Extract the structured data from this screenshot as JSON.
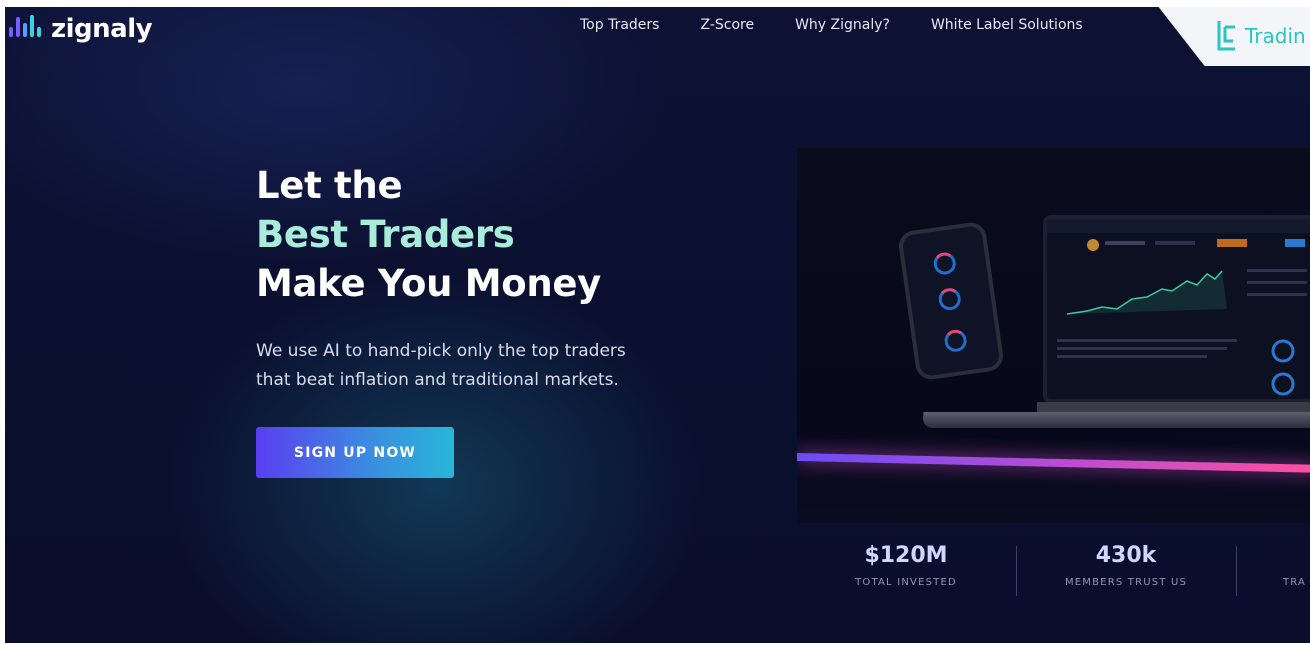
{
  "header": {
    "brand": "zignaly",
    "nav": [
      {
        "label": "Top Traders"
      },
      {
        "label": "Z-Score"
      },
      {
        "label": "Why Zignaly?"
      },
      {
        "label": "White Label Solutions"
      }
    ],
    "corner_badge_text": "Tradin"
  },
  "hero": {
    "title_line1": "Let the",
    "title_line2": "Best Traders",
    "title_line3": "Make You Money",
    "subtitle_line1": "We use AI to hand-pick only the top traders",
    "subtitle_line2": "that beat inflation and traditional markets.",
    "cta_label": "SIGN UP NOW"
  },
  "stats": [
    {
      "value": "$120M",
      "label": "TOTAL INVESTED"
    },
    {
      "value": "430k",
      "label": "MEMBERS TRUST US"
    },
    {
      "value": "",
      "label": "TRA"
    }
  ],
  "colors": {
    "background": "#0b1030",
    "accent_text": "#a8ecd9",
    "cta_start": "#5b3ef0",
    "cta_end": "#27b7d8",
    "stat_value": "#cfd6ff",
    "badge_teal": "#2bc4c4"
  },
  "icons": {
    "logo": "zignaly-bars-logo-icon",
    "badge": "tradingfinder-logo-icon"
  }
}
